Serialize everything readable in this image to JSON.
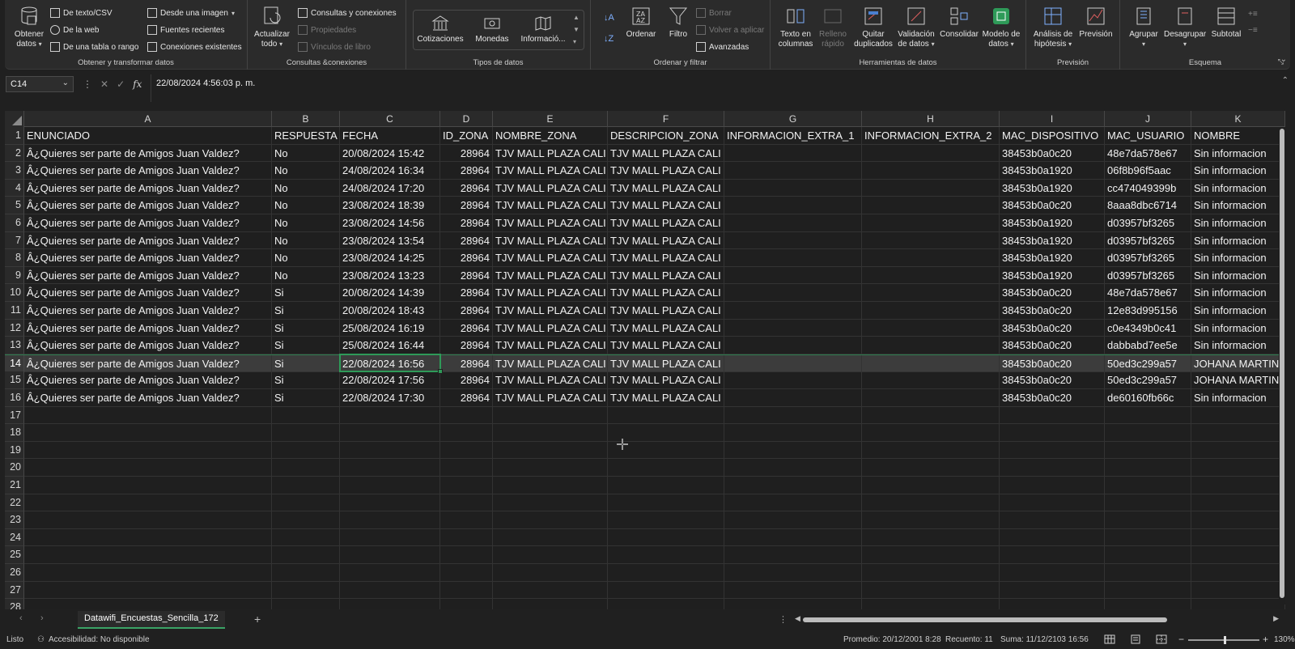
{
  "ribbon": {
    "get_data": {
      "label": "Obtener datos",
      "group": "Obtener y transformar datos",
      "items": [
        "De texto/CSV",
        "De la web",
        "De una tabla o rango",
        "Desde una imagen",
        "Fuentes recientes",
        "Conexiones existentes"
      ]
    },
    "queries": {
      "refresh": "Actualizar todo",
      "group": "Consultas &conexiones",
      "items": [
        "Consultas y conexiones",
        "Propiedades",
        "Vínculos de libro"
      ]
    },
    "data_types": {
      "group": "Tipos de datos",
      "items": [
        "Cotizaciones",
        "Monedas",
        "Informació..."
      ]
    },
    "sort_filter": {
      "group": "Ordenar y filtrar",
      "sort": "Ordenar",
      "filter": "Filtro",
      "clear": "Borrar",
      "reapply": "Volver a aplicar",
      "advanced": "Avanzadas"
    },
    "data_tools": {
      "group": "Herramientas de datos",
      "items": [
        "Texto en columnas",
        "Relleno rápido",
        "Quitar duplicados",
        "Validación de datos",
        "Consolidar",
        "Modelo de datos"
      ]
    },
    "forecast": {
      "group": "Previsión",
      "items": [
        "Análisis de hipótesis",
        "Previsión"
      ]
    },
    "outline": {
      "group": "Esquema",
      "items": [
        "Agrupar",
        "Desagrupar",
        "Subtotal"
      ]
    }
  },
  "formula_bar": {
    "name_box": "C14",
    "fx": "fx",
    "value": "22/08/2024  4:56:03 p. m."
  },
  "grid": {
    "columns": [
      "A",
      "B",
      "C",
      "D",
      "E",
      "F",
      "G",
      "H",
      "I",
      "J",
      "K"
    ],
    "headers": [
      "ENUNCIADO",
      "RESPUESTA",
      "FECHA",
      "ID_ZONA",
      "NOMBRE_ZONA",
      "DESCRIPCION_ZONA",
      "INFORMACION_EXTRA_1",
      "INFORMACION_EXTRA_2",
      "MAC_DISPOSITIVO",
      "MAC_USUARIO",
      "NOMBRE"
    ],
    "row_numbers": [
      "1",
      "2",
      "3",
      "4",
      "5",
      "6",
      "7",
      "8",
      "9",
      "10",
      "11",
      "12",
      "13",
      "14",
      "15",
      "16",
      "17",
      "18",
      "19",
      "20",
      "21",
      "22",
      "23",
      "24",
      "25",
      "26",
      "27",
      "28"
    ],
    "rows": [
      [
        "Â¿Quieres ser parte de Amigos Juan Valdez?",
        "No",
        "20/08/2024 15:42",
        "28964",
        "TJV MALL PLAZA CALI",
        "TJV MALL PLAZA CALI",
        "",
        "",
        "38453b0a0c20",
        "48e7da578e67",
        "Sin informacion"
      ],
      [
        "Â¿Quieres ser parte de Amigos Juan Valdez?",
        "No",
        "24/08/2024 16:34",
        "28964",
        "TJV MALL PLAZA CALI",
        "TJV MALL PLAZA CALI",
        "",
        "",
        "38453b0a1920",
        "06f8b96f5aac",
        "Sin informacion"
      ],
      [
        "Â¿Quieres ser parte de Amigos Juan Valdez?",
        "No",
        "24/08/2024 17:20",
        "28964",
        "TJV MALL PLAZA CALI",
        "TJV MALL PLAZA CALI",
        "",
        "",
        "38453b0a1920",
        "cc474049399b",
        "Sin informacion"
      ],
      [
        "Â¿Quieres ser parte de Amigos Juan Valdez?",
        "No",
        "23/08/2024 18:39",
        "28964",
        "TJV MALL PLAZA CALI",
        "TJV MALL PLAZA CALI",
        "",
        "",
        "38453b0a0c20",
        "8aaa8dbc6714",
        "Sin informacion"
      ],
      [
        "Â¿Quieres ser parte de Amigos Juan Valdez?",
        "No",
        "23/08/2024 14:56",
        "28964",
        "TJV MALL PLAZA CALI",
        "TJV MALL PLAZA CALI",
        "",
        "",
        "38453b0a1920",
        "d03957bf3265",
        "Sin informacion"
      ],
      [
        "Â¿Quieres ser parte de Amigos Juan Valdez?",
        "No",
        "23/08/2024 13:54",
        "28964",
        "TJV MALL PLAZA CALI",
        "TJV MALL PLAZA CALI",
        "",
        "",
        "38453b0a1920",
        "d03957bf3265",
        "Sin informacion"
      ],
      [
        "Â¿Quieres ser parte de Amigos Juan Valdez?",
        "No",
        "23/08/2024 14:25",
        "28964",
        "TJV MALL PLAZA CALI",
        "TJV MALL PLAZA CALI",
        "",
        "",
        "38453b0a1920",
        "d03957bf3265",
        "Sin informacion"
      ],
      [
        "Â¿Quieres ser parte de Amigos Juan Valdez?",
        "No",
        "23/08/2024 13:23",
        "28964",
        "TJV MALL PLAZA CALI",
        "TJV MALL PLAZA CALI",
        "",
        "",
        "38453b0a1920",
        "d03957bf3265",
        "Sin informacion"
      ],
      [
        "Â¿Quieres ser parte de Amigos Juan Valdez?",
        "Si",
        "20/08/2024 14:39",
        "28964",
        "TJV MALL PLAZA CALI",
        "TJV MALL PLAZA CALI",
        "",
        "",
        "38453b0a0c20",
        "48e7da578e67",
        "Sin informacion"
      ],
      [
        "Â¿Quieres ser parte de Amigos Juan Valdez?",
        "Si",
        "20/08/2024 18:43",
        "28964",
        "TJV MALL PLAZA CALI",
        "TJV MALL PLAZA CALI",
        "",
        "",
        "38453b0a0c20",
        "12e83d995156",
        "Sin informacion"
      ],
      [
        "Â¿Quieres ser parte de Amigos Juan Valdez?",
        "Si",
        "25/08/2024 16:19",
        "28964",
        "TJV MALL PLAZA CALI",
        "TJV MALL PLAZA CALI",
        "",
        "",
        "38453b0a0c20",
        "c0e4349b0c41",
        "Sin informacion"
      ],
      [
        "Â¿Quieres ser parte de Amigos Juan Valdez?",
        "Si",
        "25/08/2024 16:44",
        "28964",
        "TJV MALL PLAZA CALI",
        "TJV MALL PLAZA CALI",
        "",
        "",
        "38453b0a0c20",
        "dabbabd7ee5e",
        "Sin informacion"
      ],
      [
        "Â¿Quieres ser parte de Amigos Juan Valdez?",
        "Si",
        "22/08/2024 16:56",
        "28964",
        "TJV MALL PLAZA CALI",
        "TJV MALL PLAZA CALI",
        "",
        "",
        "38453b0a0c20",
        "50ed3c299a57",
        "JOHANA  MARTIN"
      ],
      [
        "Â¿Quieres ser parte de Amigos Juan Valdez?",
        "Si",
        "22/08/2024 17:56",
        "28964",
        "TJV MALL PLAZA CALI",
        "TJV MALL PLAZA CALI",
        "",
        "",
        "38453b0a0c20",
        "50ed3c299a57",
        "JOHANA  MARTIN"
      ],
      [
        "Â¿Quieres ser parte de Amigos Juan Valdez?",
        "Si",
        "22/08/2024 17:30",
        "28964",
        "TJV MALL PLAZA CALI",
        "TJV MALL PLAZA CALI",
        "",
        "",
        "38453b0a0c20",
        "de60160fb66c",
        "Sin informacion"
      ]
    ]
  },
  "sheet_tabs": {
    "active": "Datawifi_Encuestas_Sencilla_172",
    "add": "+"
  },
  "status_bar": {
    "ready": "Listo",
    "accessibility": "Accesibilidad: No disponible",
    "average": "Promedio: 20/12/2001 8:28",
    "count": "Recuento: 11",
    "sum": "Suma: 11/12/2103 16:56",
    "zoom": "130%"
  },
  "colors": {
    "accent": "#2e9a58",
    "background": "#1f1f1f",
    "ribbon": "#2b2b2b"
  }
}
